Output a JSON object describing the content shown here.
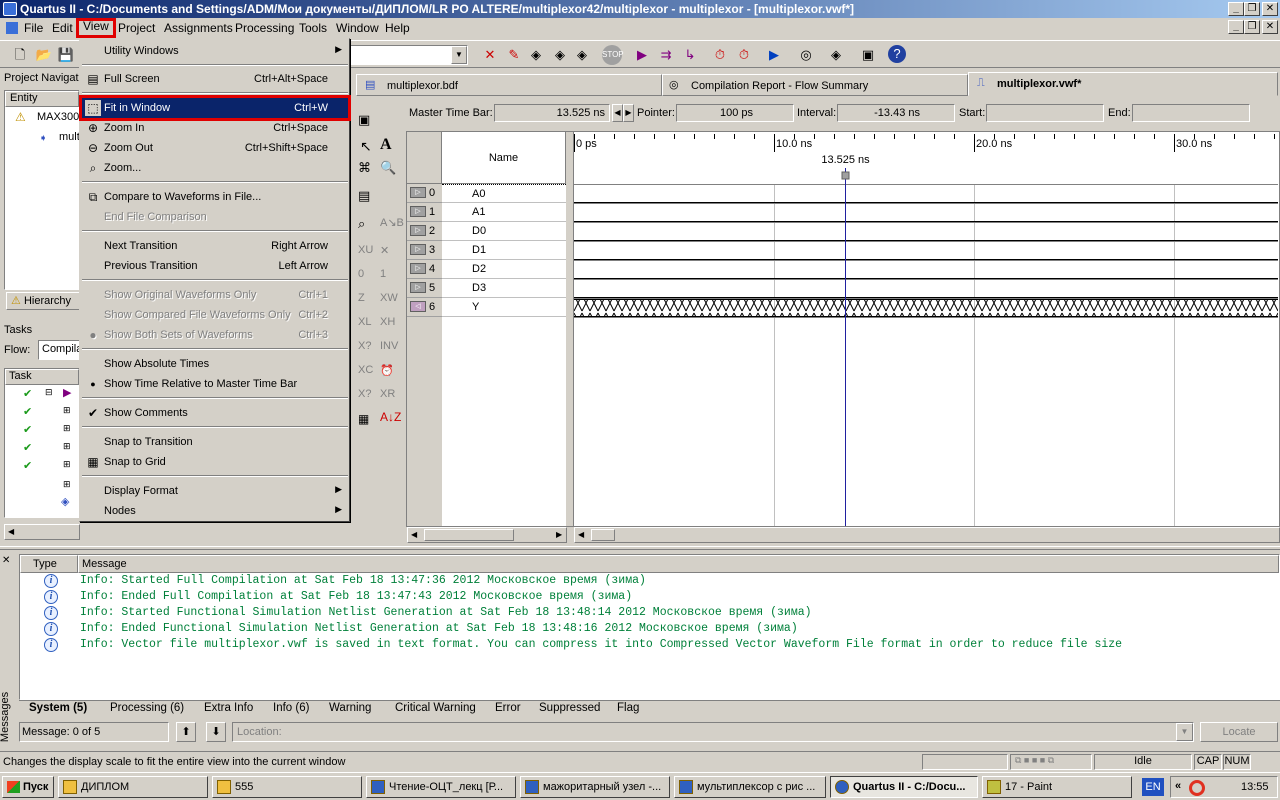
{
  "window": {
    "title": "Quartus II - C:/Documents and Settings/ADM/Мои документы/ДИПЛОМ/LR PO ALTERE/multiplexor42/multiplexor - multiplexor - [multiplexor.vwf*]"
  },
  "menubar": [
    "File",
    "Edit",
    "View",
    "Project",
    "Assignments",
    "Processing",
    "Tools",
    "Window",
    "Help"
  ],
  "view_menu": {
    "items": [
      {
        "label": "Utility Windows",
        "shortcut": "",
        "submenu": true,
        "disabled": false,
        "icon": ""
      },
      {
        "label": "Full Screen",
        "shortcut": "Ctrl+Alt+Space",
        "submenu": false,
        "disabled": false,
        "icon": "fullscreen-icon"
      },
      {
        "label": "Fit in Window",
        "shortcut": "Ctrl+W",
        "submenu": false,
        "disabled": false,
        "icon": "fit-window-icon",
        "highlighted": true
      },
      {
        "label": "Zoom In",
        "shortcut": "Ctrl+Space",
        "submenu": false,
        "disabled": false,
        "icon": "zoom-in-icon"
      },
      {
        "label": "Zoom Out",
        "shortcut": "Ctrl+Shift+Space",
        "submenu": false,
        "disabled": false,
        "icon": "zoom-out-icon"
      },
      {
        "label": "Zoom...",
        "shortcut": "",
        "submenu": false,
        "disabled": false,
        "icon": "zoom-dialog-icon"
      },
      {
        "label": "Compare to Waveforms in File...",
        "shortcut": "",
        "submenu": false,
        "disabled": false,
        "icon": "compare-icon"
      },
      {
        "label": "End File Comparison",
        "shortcut": "",
        "submenu": false,
        "disabled": true,
        "icon": ""
      },
      {
        "label": "Next Transition",
        "shortcut": "Right Arrow",
        "submenu": false,
        "disabled": false,
        "icon": ""
      },
      {
        "label": "Previous Transition",
        "shortcut": "Left Arrow",
        "submenu": false,
        "disabled": false,
        "icon": ""
      },
      {
        "label": "Show Original Waveforms Only",
        "shortcut": "Ctrl+1",
        "submenu": false,
        "disabled": true,
        "icon": ""
      },
      {
        "label": "Show Compared File Waveforms Only",
        "shortcut": "Ctrl+2",
        "submenu": false,
        "disabled": true,
        "icon": ""
      },
      {
        "label": "Show Both Sets of Waveforms",
        "shortcut": "Ctrl+3",
        "submenu": false,
        "disabled": true,
        "icon": "bullet"
      },
      {
        "label": "Show Absolute Times",
        "shortcut": "",
        "submenu": false,
        "disabled": false,
        "icon": ""
      },
      {
        "label": "Show Time Relative to Master Time Bar",
        "shortcut": "",
        "submenu": false,
        "disabled": false,
        "icon": "bullet"
      },
      {
        "label": "Show Comments",
        "shortcut": "",
        "submenu": false,
        "disabled": false,
        "icon": "check"
      },
      {
        "label": "Snap to Transition",
        "shortcut": "",
        "submenu": false,
        "disabled": false,
        "icon": ""
      },
      {
        "label": "Snap to Grid",
        "shortcut": "",
        "submenu": false,
        "disabled": false,
        "icon": "grid-icon"
      },
      {
        "label": "Display Format",
        "shortcut": "",
        "submenu": true,
        "disabled": false,
        "icon": ""
      },
      {
        "label": "Nodes",
        "shortcut": "",
        "submenu": true,
        "disabled": false,
        "icon": ""
      }
    ]
  },
  "left_panel": {
    "project_nav_title": "Project Navigat",
    "entity_header": "Entity",
    "entity_device": "MAX300",
    "entity_child": "mult",
    "hierarchy_tab": "Hierarchy",
    "tasks_title": "Tasks",
    "flow_label": "Flow:",
    "flow_value": "Compila",
    "task_header": "Task"
  },
  "doc_tabs": [
    "multiplexor.bdf",
    "Compilation Report - Flow Summary",
    "multiplexor.vwf*"
  ],
  "timebar": {
    "master_label": "Master Time Bar:",
    "master_value": "13.525 ns",
    "pointer_label": "Pointer:",
    "pointer_value": "100 ps",
    "interval_label": "Interval:",
    "interval_value": "-13.43 ns",
    "start_label": "Start:",
    "start_value": "",
    "end_label": "End:",
    "end_value": ""
  },
  "waveform": {
    "name_header": "Name",
    "time_ticks": [
      "0 ps",
      "10.0 ns",
      "20.0 ns",
      "30.0 ns"
    ],
    "cursor_label": "13.525 ns",
    "signals": [
      {
        "index": "0",
        "name": "A0",
        "kind": "input"
      },
      {
        "index": "1",
        "name": "A1",
        "kind": "input"
      },
      {
        "index": "2",
        "name": "D0",
        "kind": "input"
      },
      {
        "index": "3",
        "name": "D1",
        "kind": "input"
      },
      {
        "index": "4",
        "name": "D2",
        "kind": "input"
      },
      {
        "index": "5",
        "name": "D3",
        "kind": "input"
      },
      {
        "index": "6",
        "name": "Y",
        "kind": "output"
      }
    ]
  },
  "messages": {
    "col_type": "Type",
    "col_message": "Message",
    "lines": [
      "Info: Started Full Compilation at Sat Feb 18 13:47:36 2012 Московское время (зима)",
      "Info: Ended Full Compilation at Sat Feb 18 13:47:43 2012 Московское время (зима)",
      "Info: Started Functional Simulation Netlist Generation at Sat Feb 18 13:48:14 2012 Московское время (зима)",
      "Info: Ended Functional Simulation Netlist Generation at Sat Feb 18 13:48:16 2012 Московское время (зима)",
      "Info: Vector file multiplexor.vwf is saved in text format. You can compress it into Compressed Vector Waveform File format in order to reduce file size"
    ],
    "tabs": [
      "System (5)",
      "Processing (6)",
      "Extra Info",
      "Info (6)",
      "Warning",
      "Critical Warning",
      "Error",
      "Suppressed",
      "Flag"
    ],
    "side_label": "Messages",
    "count": "Message: 0 of 5",
    "location_placeholder": "Location:",
    "locate_button": "Locate"
  },
  "statusbar": {
    "text": "Changes the display scale to fit the entire view into the current window",
    "state": "Idle",
    "cap": "CAP",
    "num": "NUM"
  },
  "taskbar": {
    "start": "Пуск",
    "tasks": [
      "ДИПЛОМ",
      "555",
      "Чтение-ОЦТ_лекц [Р...",
      "мажоритарный узел -...",
      "мультиплексор с рис ...",
      "Quartus II - C:/Docu...",
      "17 - Paint"
    ],
    "lang": "EN",
    "clock": "13:55"
  },
  "colors": {
    "title_start": "#0a246a",
    "highlight": "#0a246a",
    "annotation_red": "#e00000",
    "info_green": "#00803a",
    "cursor_blue": "#2020a0"
  }
}
